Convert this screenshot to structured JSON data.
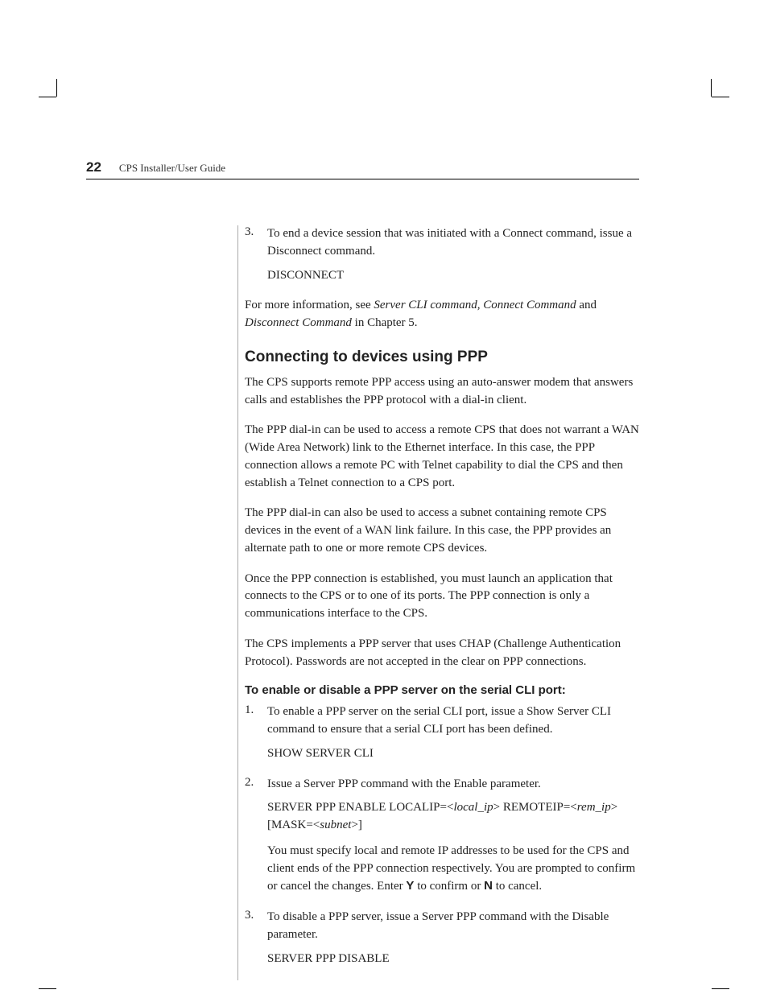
{
  "header": {
    "page_number": "22",
    "doc_title": "CPS Installer/User Guide"
  },
  "step3_top": {
    "num": "3.",
    "text_a": "To end a device session that was initiated with a Connect command, issue a Disconnect command.",
    "cmd": "DISCONNECT"
  },
  "more_info_pre": "For more information, see ",
  "more_info_em1": "Server CLI command, Connect Command",
  "more_info_mid": " and ",
  "more_info_em2": "Disconnect Command",
  "more_info_post": " in Chapter 5.",
  "h2": "Connecting to devices using PPP",
  "p1": "The CPS supports remote PPP access using an auto-answer modem that answers calls and establishes the PPP protocol with a dial-in client.",
  "p2": "The PPP dial-in can be used to access a remote CPS that does not warrant a WAN (Wide Area Network) link to the Ethernet interface. In this case, the PPP connection allows a remote PC with Telnet capability to dial the CPS and then establish a Telnet connection to a CPS port.",
  "p3": "The PPP dial-in can also be used to access a subnet containing remote CPS devices in the event of a WAN link failure. In this case, the PPP provides an alternate path to one or more remote CPS devices.",
  "p4": "Once the PPP connection is established, you must launch an application that connects to the CPS or to one of its ports. The PPP connection is only a communications interface to the CPS.",
  "p5": "The CPS implements a PPP server that uses CHAP (Challenge Authentication Protocol). Passwords are not accepted in the clear on PPP connections.",
  "h3": "To enable or disable a PPP server on the serial CLI port:",
  "step1": {
    "num": "1.",
    "text": "To enable a PPP server on the serial CLI port, issue a Show Server CLI command to ensure that a serial CLI port has been defined.",
    "cmd": "SHOW SERVER CLI"
  },
  "step2": {
    "num": "2.",
    "text": "Issue a Server PPP command with the Enable parameter.",
    "cmd_pre": "SERVER PPP ENABLE LOCALIP=<",
    "cmd_em1": "local_ip",
    "cmd_mid1": "> REMOTEIP=<",
    "cmd_em2": "rem_ip",
    "cmd_mid2": "> [MASK=<",
    "cmd_em3": "subnet",
    "cmd_post": ">]",
    "sub_pre": "You must specify local and remote IP addresses to be used for the CPS and client ends of the PPP connection respectively. You are prompted to confirm or cancel the changes. Enter ",
    "sub_y": "Y",
    "sub_mid": " to confirm or ",
    "sub_n": "N",
    "sub_post": " to cancel."
  },
  "step3": {
    "num": "3.",
    "text": "To disable a PPP server, issue a Server PPP command with the Disable parameter.",
    "cmd": "SERVER PPP DISABLE"
  }
}
